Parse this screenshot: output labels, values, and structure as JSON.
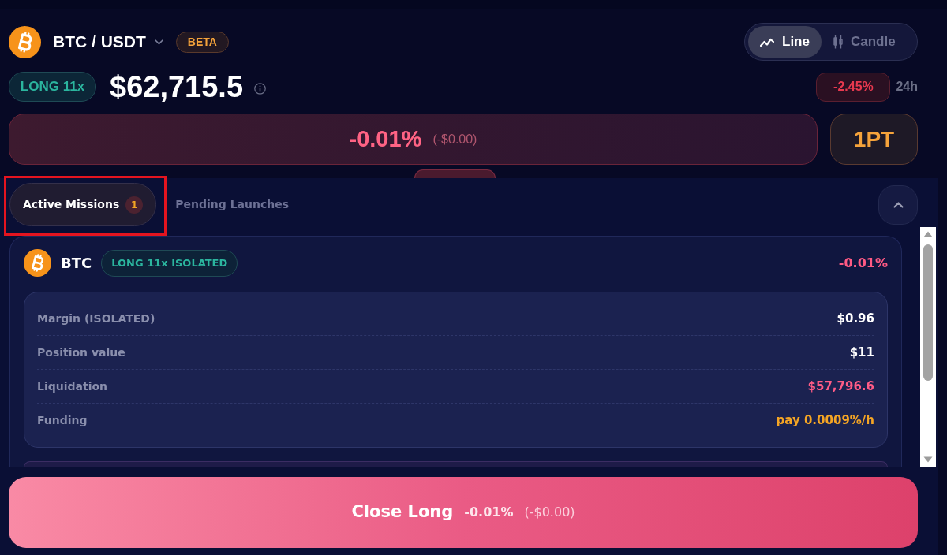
{
  "header": {
    "pair": "BTC / USDT",
    "tag": "BETA",
    "chart_modes": [
      {
        "label": "Line",
        "kind": "line",
        "selected": true
      },
      {
        "label": "Candle",
        "kind": "candle",
        "selected": false
      }
    ]
  },
  "ticker": {
    "side": "LONG 11x",
    "price": "$62,715.5",
    "change": "-2.45%",
    "period": "24h"
  },
  "pnl": {
    "percent": "-0.01%",
    "amount": "(-$0.00)"
  },
  "points": "1PT",
  "missions_panel": {
    "expanded": true,
    "tabs": [
      {
        "label": "Active Missions",
        "count": "1",
        "selected": true,
        "highlighted": true
      },
      {
        "label": "Pending Launches",
        "selected": false,
        "highlighted": false
      }
    ],
    "positions": [
      {
        "asset": "BTC",
        "tag": "LONG 11x ISOLATED",
        "pnl": "-0.01%",
        "details": [
          {
            "label": "Margin (ISOLATED)",
            "value": "$0.96",
            "color": "#ffffff"
          },
          {
            "label": "Position value",
            "value": "$11",
            "color": "#ffffff"
          },
          {
            "label": "Liquidation",
            "value": "$57,796.6",
            "color": "#ff5c86"
          },
          {
            "label": "Funding",
            "value": "pay 0.0009%/h",
            "color": "#f5a524"
          }
        ]
      }
    ]
  },
  "close_button": {
    "label": "Close Long",
    "percent": "-0.01%",
    "amount": "(-$0.00)"
  }
}
